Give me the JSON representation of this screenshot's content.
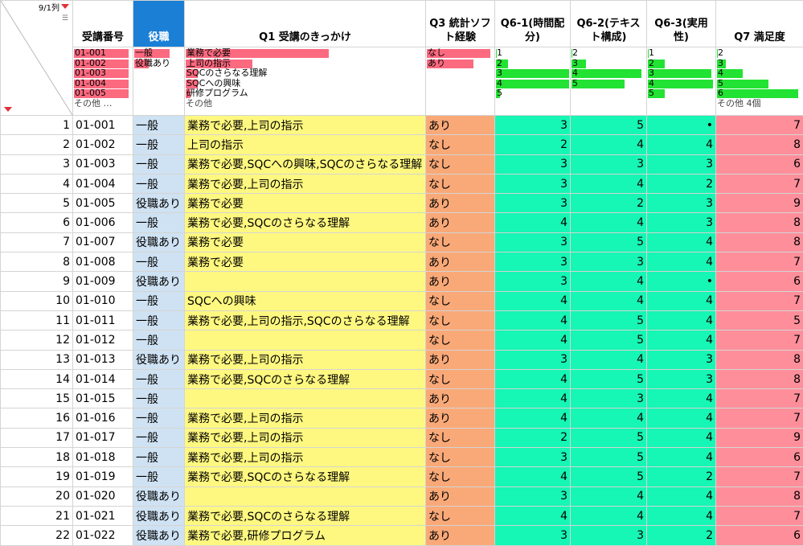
{
  "corner": {
    "cols_label": "9/1列"
  },
  "columns": [
    {
      "key": "id",
      "label": "受講番号"
    },
    {
      "key": "role",
      "label": "役職"
    },
    {
      "key": "q1",
      "label": "Q1 受講のきっかけ"
    },
    {
      "key": "q3",
      "label": "Q3 統計ソフト経験"
    },
    {
      "key": "q61",
      "label": "Q6-1(時間配分)"
    },
    {
      "key": "q62",
      "label": "Q6-2(テキスト構成)"
    },
    {
      "key": "q63",
      "label": "Q6-3(実用性)"
    },
    {
      "key": "q7",
      "label": "Q7 満足度"
    }
  ],
  "summary": {
    "id": {
      "items": [
        {
          "label": "01-001",
          "frac": 0.95
        },
        {
          "label": "01-002",
          "frac": 0.95
        },
        {
          "label": "01-003",
          "frac": 0.95
        },
        {
          "label": "01-004",
          "frac": 0.95
        },
        {
          "label": "01-005",
          "frac": 0.95
        }
      ],
      "other": "その他 …"
    },
    "role": {
      "items": [
        {
          "label": "一般",
          "frac": 0.72
        },
        {
          "label": "役職あり",
          "frac": 0.3
        }
      ],
      "other": ""
    },
    "q1": {
      "items": [
        {
          "label": "業務で必要",
          "frac": 0.6
        },
        {
          "label": "上司の指示",
          "frac": 0.28
        },
        {
          "label": "SQCのさらなる理解",
          "frac": 0.05
        },
        {
          "label": "SQCへの興味",
          "frac": 0.05
        },
        {
          "label": "研修プログラム",
          "frac": 0.02
        }
      ],
      "other": "その他"
    },
    "q3": {
      "items": [
        {
          "label": "なし",
          "frac": 0.95
        },
        {
          "label": "あり",
          "frac": 0.7
        }
      ],
      "other": ""
    },
    "q61": {
      "items": [
        {
          "label": "1",
          "frac": 0.01
        },
        {
          "label": "2",
          "frac": 0.16
        },
        {
          "label": "3",
          "frac": 1.0
        },
        {
          "label": "4",
          "frac": 1.0
        },
        {
          "label": "5",
          "frac": 0.05
        }
      ],
      "other": ""
    },
    "q62": {
      "items": [
        {
          "label": "2",
          "frac": 0.01
        },
        {
          "label": "3",
          "frac": 0.2
        },
        {
          "label": "4",
          "frac": 0.95
        },
        {
          "label": "5",
          "frac": 0.72
        }
      ],
      "other": ""
    },
    "q63": {
      "items": [
        {
          "label": "1",
          "frac": 0.01
        },
        {
          "label": "2",
          "frac": 0.25
        },
        {
          "label": "3",
          "frac": 0.95
        },
        {
          "label": "4",
          "frac": 0.98
        },
        {
          "label": "5",
          "frac": 0.25
        }
      ],
      "other": ""
    },
    "q7": {
      "items": [
        {
          "label": "2",
          "frac": 0.01
        },
        {
          "label": "3",
          "frac": 0.1
        },
        {
          "label": "4",
          "frac": 0.3
        },
        {
          "label": "5",
          "frac": 0.6
        },
        {
          "label": "6",
          "frac": 0.95
        }
      ],
      "other": "その他 4個"
    }
  },
  "colors": {
    "bar_pink": "#fc6a80",
    "bar_green": "#22e233",
    "role_bg": "#cfe2f3",
    "q1_bg": "#fff880",
    "q3_bg": "#f9a978",
    "q6_bg": "#16f6b4",
    "q7_bg": "#fe8f9a",
    "selected_header": "#1b7fd6"
  },
  "rows": [
    {
      "n": "1",
      "id": "01-001",
      "role": "一般",
      "q1": "業務で必要,上司の指示",
      "q3": "あり",
      "q61": "3",
      "q62": "5",
      "q63": "•",
      "q7": "7"
    },
    {
      "n": "2",
      "id": "01-002",
      "role": "一般",
      "q1": "上司の指示",
      "q3": "なし",
      "q61": "2",
      "q62": "4",
      "q63": "4",
      "q7": "8"
    },
    {
      "n": "3",
      "id": "01-003",
      "role": "一般",
      "q1": "業務で必要,SQCへの興味,SQCのさらなる理解",
      "q3": "なし",
      "q61": "3",
      "q62": "3",
      "q63": "3",
      "q7": "6"
    },
    {
      "n": "4",
      "id": "01-004",
      "role": "一般",
      "q1": "業務で必要,上司の指示",
      "q3": "なし",
      "q61": "3",
      "q62": "4",
      "q63": "2",
      "q7": "7"
    },
    {
      "n": "5",
      "id": "01-005",
      "role": "役職あり",
      "q1": "業務で必要",
      "q3": "あり",
      "q61": "3",
      "q62": "2",
      "q63": "3",
      "q7": "9"
    },
    {
      "n": "6",
      "id": "01-006",
      "role": "一般",
      "q1": "業務で必要,SQCのさらなる理解",
      "q3": "あり",
      "q61": "4",
      "q62": "4",
      "q63": "3",
      "q7": "8"
    },
    {
      "n": "7",
      "id": "01-007",
      "role": "役職あり",
      "q1": "業務で必要",
      "q3": "なし",
      "q61": "3",
      "q62": "5",
      "q63": "4",
      "q7": "8"
    },
    {
      "n": "8",
      "id": "01-008",
      "role": "一般",
      "q1": "業務で必要",
      "q3": "あり",
      "q61": "3",
      "q62": "3",
      "q63": "4",
      "q7": "7"
    },
    {
      "n": "9",
      "id": "01-009",
      "role": "役職あり",
      "q1": "",
      "q3": "あり",
      "q61": "3",
      "q62": "4",
      "q63": "•",
      "q7": "6"
    },
    {
      "n": "10",
      "id": "01-010",
      "role": "一般",
      "q1": "SQCへの興味",
      "q3": "なし",
      "q61": "4",
      "q62": "4",
      "q63": "4",
      "q7": "7"
    },
    {
      "n": "11",
      "id": "01-011",
      "role": "一般",
      "q1": "業務で必要,上司の指示,SQCのさらなる理解",
      "q3": "なし",
      "q61": "4",
      "q62": "5",
      "q63": "4",
      "q7": "5"
    },
    {
      "n": "12",
      "id": "01-012",
      "role": "一般",
      "q1": "",
      "q3": "なし",
      "q61": "4",
      "q62": "5",
      "q63": "4",
      "q7": "7"
    },
    {
      "n": "13",
      "id": "01-013",
      "role": "役職あり",
      "q1": "業務で必要,上司の指示",
      "q3": "あり",
      "q61": "3",
      "q62": "4",
      "q63": "3",
      "q7": "8"
    },
    {
      "n": "14",
      "id": "01-014",
      "role": "一般",
      "q1": "業務で必要,SQCのさらなる理解",
      "q3": "なし",
      "q61": "4",
      "q62": "5",
      "q63": "3",
      "q7": "8"
    },
    {
      "n": "15",
      "id": "01-015",
      "role": "一般",
      "q1": "",
      "q3": "あり",
      "q61": "4",
      "q62": "3",
      "q63": "4",
      "q7": "7"
    },
    {
      "n": "16",
      "id": "01-016",
      "role": "一般",
      "q1": "業務で必要,上司の指示",
      "q3": "あり",
      "q61": "4",
      "q62": "4",
      "q63": "4",
      "q7": "7"
    },
    {
      "n": "17",
      "id": "01-017",
      "role": "一般",
      "q1": "業務で必要,上司の指示",
      "q3": "なし",
      "q61": "2",
      "q62": "5",
      "q63": "4",
      "q7": "9"
    },
    {
      "n": "18",
      "id": "01-018",
      "role": "一般",
      "q1": "業務で必要,上司の指示",
      "q3": "なし",
      "q61": "3",
      "q62": "5",
      "q63": "4",
      "q7": "6"
    },
    {
      "n": "19",
      "id": "01-019",
      "role": "一般",
      "q1": "業務で必要,SQCのさらなる理解",
      "q3": "なし",
      "q61": "4",
      "q62": "5",
      "q63": "2",
      "q7": "7"
    },
    {
      "n": "20",
      "id": "01-020",
      "role": "役職あり",
      "q1": "",
      "q3": "あり",
      "q61": "3",
      "q62": "4",
      "q63": "4",
      "q7": "8"
    },
    {
      "n": "21",
      "id": "01-021",
      "role": "役職あり",
      "q1": "業務で必要,SQCのさらなる理解",
      "q3": "なし",
      "q61": "4",
      "q62": "4",
      "q63": "4",
      "q7": "7"
    },
    {
      "n": "22",
      "id": "01-022",
      "role": "役職あり",
      "q1": "業務で必要,研修プログラム",
      "q3": "あり",
      "q61": "3",
      "q62": "3",
      "q63": "2",
      "q7": "6"
    }
  ]
}
